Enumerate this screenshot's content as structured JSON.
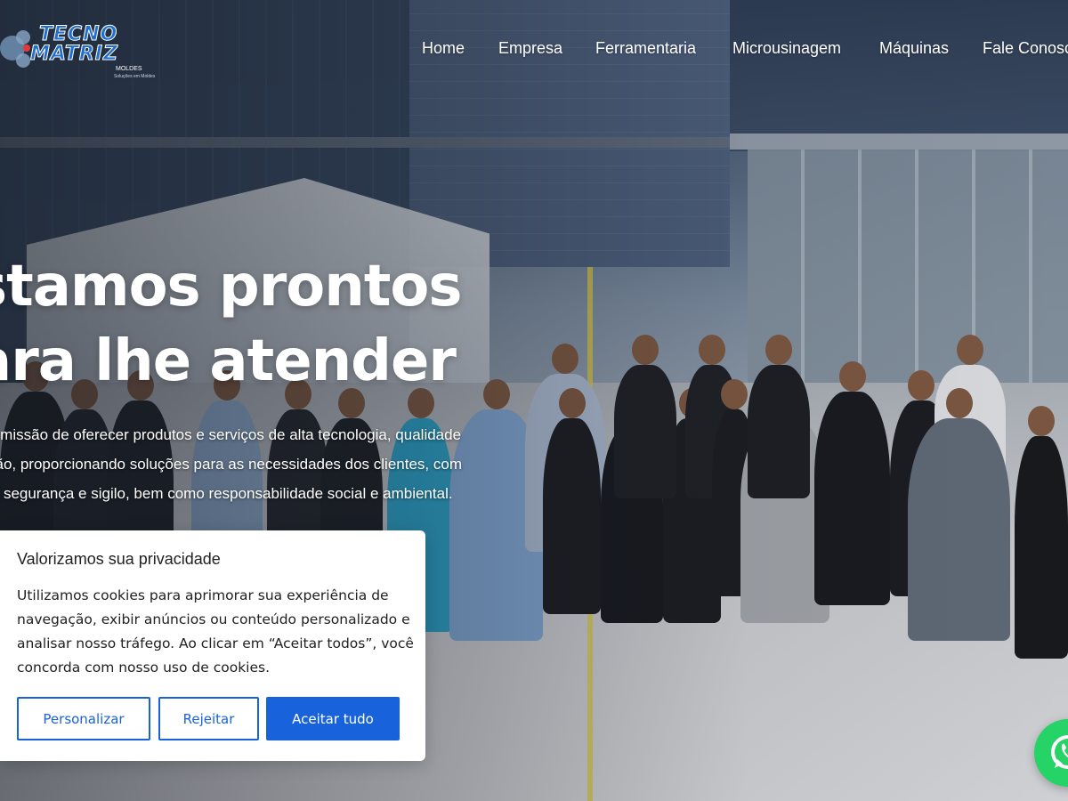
{
  "brand": {
    "line1": "TECNO",
    "line2": "MATRIZ",
    "sub": "MOLDES",
    "tagline": "Soluções em Moldes"
  },
  "nav": {
    "items": [
      {
        "label": "Home"
      },
      {
        "label": "Empresa"
      },
      {
        "label": "Ferramentaria"
      },
      {
        "label": "Microusinagem"
      },
      {
        "label": "Máquinas"
      },
      {
        "label": "Fale Conosco"
      }
    ]
  },
  "hero": {
    "headline_line1": "stamos prontos",
    "headline_line2": "ara lhe atender",
    "mission_line1": "a missão de oferecer produtos e serviços de alta tecnologia, qualidade",
    "mission_line2": "são, proporcionando soluções para as necessidades dos clientes, com",
    "mission_line3": "z, segurança e sigilo, bem como responsabilidade social e ambiental."
  },
  "cookie": {
    "title": "Valorizamos sua privacidade",
    "text_line1": "Utilizamos cookies para aprimorar sua experiência de",
    "text_line2": "navegação, exibir anúncios ou conteúdo personalizado e",
    "text_line3": "analisar nosso tráfego. Ao clicar em “Aceitar todos”, você",
    "text_line4": "concorda com nosso uso de cookies.",
    "customize_label": "Personalizar",
    "reject_label": "Rejeitar",
    "accept_label": "Aceitar tudo"
  },
  "colors": {
    "accent": "#1863dc",
    "brand_blue": "#1e6fd0",
    "whatsapp": "#25d366"
  },
  "icons": {
    "whatsapp": "whatsapp-icon",
    "logo": "tecnomatriz-logo-mark"
  }
}
